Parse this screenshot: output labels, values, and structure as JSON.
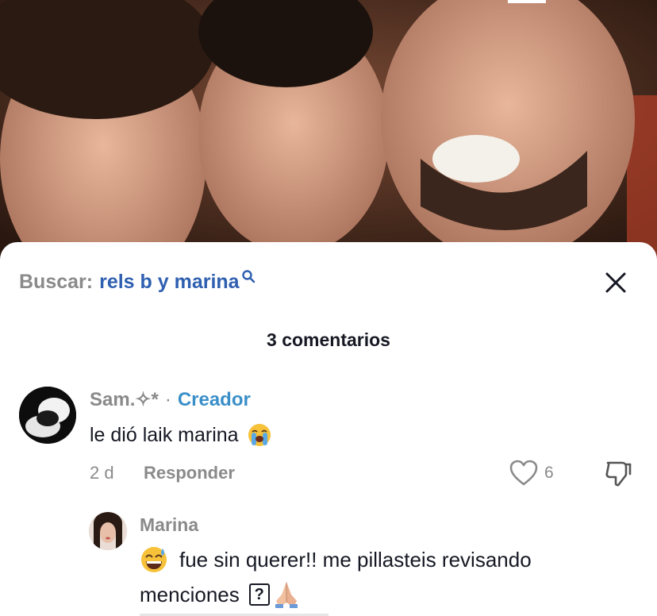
{
  "search": {
    "prefix": "Buscar:",
    "query": "rels b y marina"
  },
  "comments_header": {
    "count_label": "3 comentarios"
  },
  "comments": [
    {
      "username": "Sam.✧*",
      "separator": "·",
      "badge": "Creador",
      "text": "le dió laik marina",
      "emoji": "loudly-crying-face",
      "age": "2 d",
      "reply_label": "Responder",
      "likes": "6"
    }
  ],
  "replies": [
    {
      "username": "Marina",
      "line1": "fue sin querer!! me pillasteis revisando",
      "line2": "menciones",
      "box_glyph": "?",
      "emojis": [
        "grinning-face-with-sweat",
        "folded-hands"
      ]
    }
  ],
  "colors": {
    "accent_link": "#2f5fb0",
    "creator_badge": "#3a8fc8",
    "muted_text": "#8a8a8a",
    "primary_text": "#161823"
  }
}
